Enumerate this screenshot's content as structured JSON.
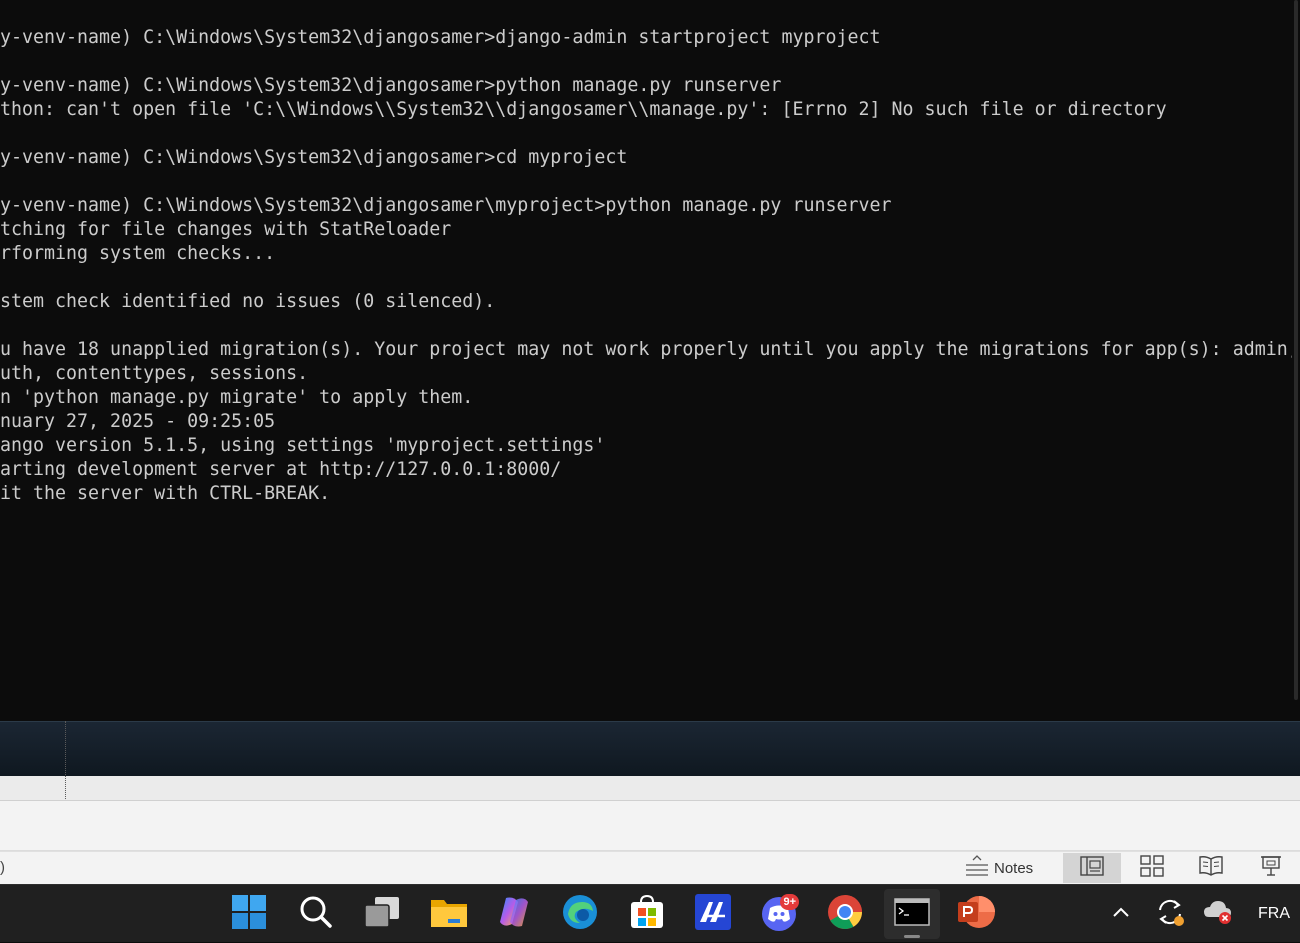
{
  "terminal": {
    "lines": [
      "y-venv-name) C:\\Windows\\System32\\djangosamer>django-admin startproject myproject",
      "",
      "y-venv-name) C:\\Windows\\System32\\djangosamer>python manage.py runserver",
      "thon: can't open file 'C:\\\\Windows\\\\System32\\\\djangosamer\\\\manage.py': [Errno 2] No such file or directory",
      "",
      "y-venv-name) C:\\Windows\\System32\\djangosamer>cd myproject",
      "",
      "y-venv-name) C:\\Windows\\System32\\djangosamer\\myproject>python manage.py runserver",
      "tching for file changes with StatReloader",
      "rforming system checks...",
      "",
      "stem check identified no issues (0 silenced).",
      "",
      "u have 18 unapplied migration(s). Your project may not work properly until you apply the migrations for app(s): admin,",
      "uth, contenttypes, sessions.",
      "n 'python manage.py migrate' to apply them.",
      "nuary 27, 2025 - 09:25:05",
      "ango version 5.1.5, using settings 'myproject.settings'",
      "arting development server at http://127.0.0.1:8000/",
      "it the server with CTRL-BREAK."
    ]
  },
  "status_bar": {
    "left_text": ")",
    "notes_label": "Notes",
    "views": [
      "normal-view",
      "slide-sorter-view",
      "reading-view",
      "slide-show-view"
    ]
  },
  "taskbar": {
    "apps": [
      "windows-start",
      "search",
      "task-view",
      "file-explorer",
      "copilot",
      "edge",
      "microsoft-store",
      "terminal-app",
      "discord",
      "chrome",
      "command-prompt",
      "powerpoint"
    ],
    "discord_badge": "9+",
    "tray_language": "FRA"
  },
  "colors": {
    "terminal_bg": "#0c0c0c",
    "terminal_text": "#cccccc",
    "taskbar_bg": "#202020",
    "status_bar_bg": "#f3f3f3"
  }
}
